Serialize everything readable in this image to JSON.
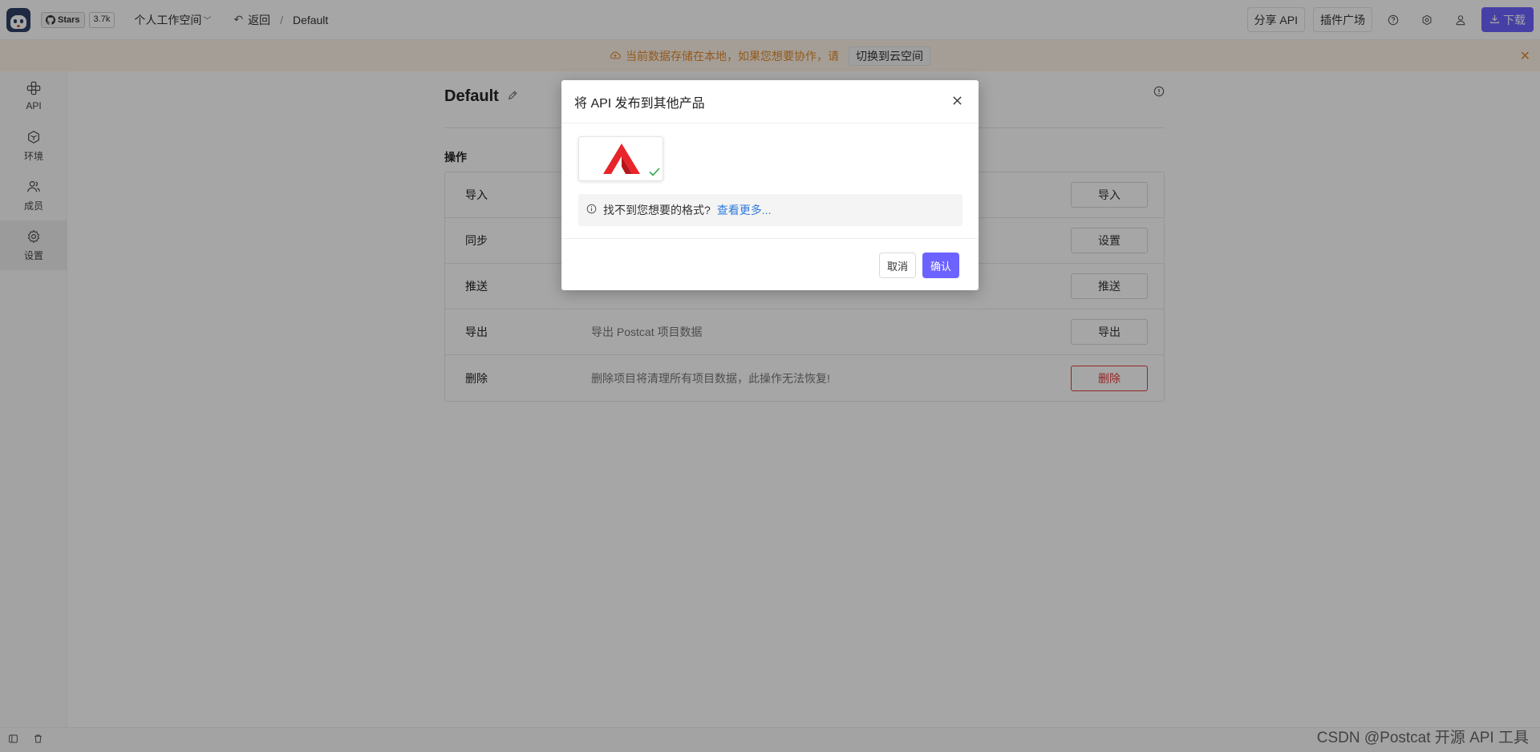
{
  "topbar": {
    "logo_icon": "postcat-cat-icon",
    "github": {
      "stars_label": "Stars",
      "stars_count": "3.7k"
    },
    "workspace": "个人工作空间",
    "back_label": "返回",
    "breadcrumb_separator": "/",
    "project_name": "Default",
    "share_api_label": "分享 API",
    "plugins_label": "插件广场",
    "download_label": "下载",
    "icons": [
      "help-icon",
      "settings-icon",
      "user-icon"
    ],
    "accent_color": "#6c63ff"
  },
  "notice": {
    "text": "当前数据存储在本地，如果您想要协作，请",
    "switch_label": "切换到云空间",
    "color": "#e08a2c"
  },
  "sidebar": {
    "items": [
      {
        "label": "API",
        "icon": "api-icon"
      },
      {
        "label": "环境",
        "icon": "environment-icon"
      },
      {
        "label": "成员",
        "icon": "members-icon"
      },
      {
        "label": "设置",
        "icon": "settings-icon",
        "active": true
      }
    ]
  },
  "main": {
    "title": "Default",
    "section_title": "操作",
    "operations": [
      {
        "name": "导入",
        "description": "",
        "button": "导入"
      },
      {
        "name": "同步",
        "description": "",
        "button": "设置"
      },
      {
        "name": "推送",
        "description": "",
        "button": "推送"
      },
      {
        "name": "导出",
        "description": "导出 Postcat 项目数据",
        "button": "导出"
      },
      {
        "name": "删除",
        "description": "删除项目将清理所有项目数据，此操作无法恢复!",
        "button": "删除",
        "danger": true
      }
    ]
  },
  "modal": {
    "title": "将 API 发布到其他产品",
    "plugin_selected": true,
    "hint_text": "找不到您想要的格式?",
    "hint_link": "查看更多...",
    "cancel_label": "取消",
    "confirm_label": "确认"
  },
  "watermark": "CSDN @Postcat 开源 API 工具"
}
